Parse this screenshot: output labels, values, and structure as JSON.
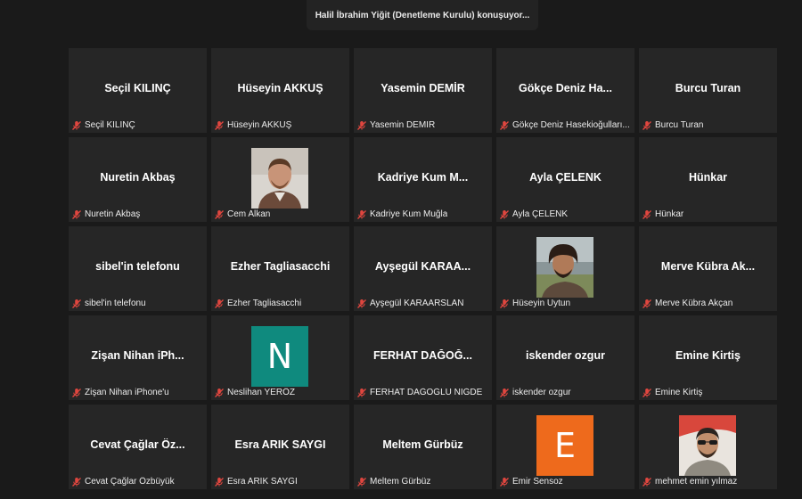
{
  "speaker_banner": "Halil İbrahim Yiğit (Denetleme Kurulu) konuşuyor...",
  "colors": {
    "background": "#1a1a1a",
    "tile": "#262626",
    "mic_muted": "#e0463f",
    "avatar_teal": "#0f8a7e",
    "avatar_orange": "#ee6a1c"
  },
  "participants": [
    {
      "name": "Seçil KILINÇ",
      "label": "Seçil KILINÇ",
      "video": "none"
    },
    {
      "name": "Hüseyin AKKUŞ",
      "label": "Hüseyin AKKUŞ",
      "video": "none"
    },
    {
      "name": "Yasemin DEMİR",
      "label": "Yasemin DEMİR",
      "video": "none"
    },
    {
      "name": "Gökçe  Deniz  Ha...",
      "label": "Gökçe Deniz Hasekioğulları...",
      "video": "none"
    },
    {
      "name": "Burcu Turan",
      "label": "Burcu Turan",
      "video": "none"
    },
    {
      "name": "Nuretin Akbaş",
      "label": "Nuretin Akbaş",
      "video": "none"
    },
    {
      "name": "",
      "label": "Cem Alkan",
      "video": "photo",
      "photo": "man-portrait-light"
    },
    {
      "name": "Kadriye Kum M...",
      "label": "Kadriye Kum Muğla",
      "video": "none"
    },
    {
      "name": "Ayla ÇELENK",
      "label": "Ayla ÇELENK",
      "video": "none"
    },
    {
      "name": "Hünkar",
      "label": "Hünkar",
      "video": "none"
    },
    {
      "name": "sibel'in telefonu",
      "label": "sibel'in telefonu",
      "video": "none"
    },
    {
      "name": "Ezher Tagliasacchi",
      "label": "Ezher Tagliasacchi",
      "video": "none"
    },
    {
      "name": "Ayşegül KARAA...",
      "label": "Ayşegül KARAARSLAN",
      "video": "none"
    },
    {
      "name": "",
      "label": "Hüseyin Uytun",
      "video": "photo",
      "photo": "man-portrait-outdoor"
    },
    {
      "name": "Merve Kübra Ak...",
      "label": "Merve Kübra Akçan",
      "video": "none"
    },
    {
      "name": "Zişan Nihan   iPh...",
      "label": "Zişan Nihan  iPhone'u",
      "video": "none"
    },
    {
      "name": "",
      "label": "Neslihan YERÖZ",
      "video": "letter",
      "letter": "N",
      "avatar_color": "#0f8a7e"
    },
    {
      "name": "FERHAT DAĞOĞ...",
      "label": "FERHAT DAĞOĞLU NİĞDE",
      "video": "none"
    },
    {
      "name": "iskender ozgur",
      "label": "iskender ozgur",
      "video": "none"
    },
    {
      "name": "Emine Kirtiş",
      "label": "Emine Kirtiş",
      "video": "none"
    },
    {
      "name": "Cevat  Çağlar  Öz...",
      "label": "Cevat Çağlar Özbüyük",
      "video": "none"
    },
    {
      "name": "Esra ARIK SAYGI",
      "label": "Esra ARIK SAYGI",
      "video": "none"
    },
    {
      "name": "Meltem Gürbüz",
      "label": "Meltem Gürbüz",
      "video": "none"
    },
    {
      "name": "",
      "label": "Emir Sensoz",
      "video": "letter",
      "letter": "E",
      "avatar_color": "#ee6a1c"
    },
    {
      "name": "",
      "label": "mehmet emin yılmaz",
      "video": "photo",
      "photo": "man-portrait-sunglasses"
    }
  ]
}
